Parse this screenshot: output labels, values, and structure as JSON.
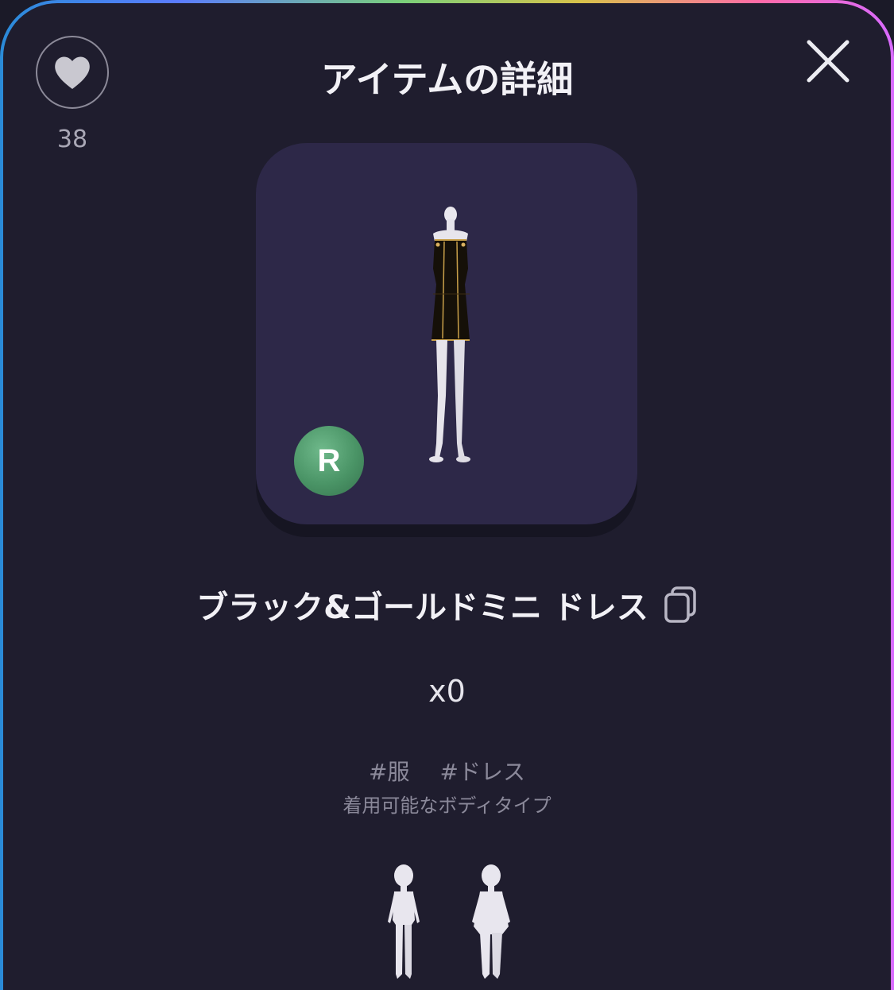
{
  "header": {
    "title": "アイテムの詳細",
    "like_count": "38"
  },
  "item": {
    "rarity": "R",
    "name": "ブラック&ゴールドミニ ドレス",
    "quantity": "x0",
    "tags": [
      "#服",
      "#ドレス"
    ],
    "body_type_label": "着用可能なボディタイプ"
  },
  "icons": {
    "like": "heart-icon",
    "close": "close-icon",
    "copy": "copy-icon"
  },
  "colors": {
    "background": "#1f1d2e",
    "card": "#2d2848",
    "rarity_badge": "#4a9466",
    "text": "#f2f1f6",
    "muted_text": "#8b899a"
  }
}
